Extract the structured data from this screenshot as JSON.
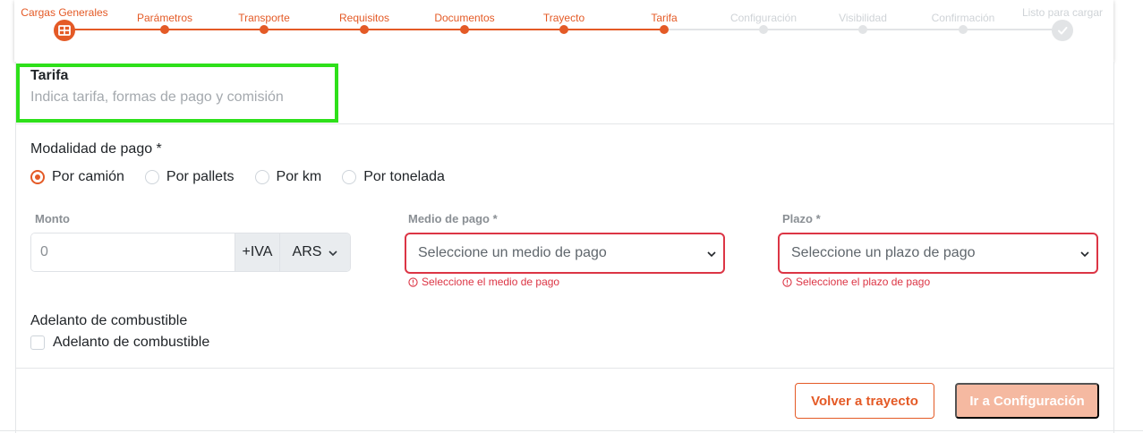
{
  "stepper": {
    "steps": [
      {
        "label": "Cargas Generales"
      },
      {
        "label": "Parámetros"
      },
      {
        "label": "Transporte"
      },
      {
        "label": "Requisitos"
      },
      {
        "label": "Documentos"
      },
      {
        "label": "Trayecto"
      },
      {
        "label": "Tarifa"
      },
      {
        "label": "Configuración"
      },
      {
        "label": "Visibilidad"
      },
      {
        "label": "Confirmación"
      },
      {
        "label": "Listo para cargar"
      }
    ],
    "active_color": "#e45a26",
    "pending_color": "#e2e4e6"
  },
  "section": {
    "title": "Tarifa",
    "subtitle": "Indica tarifa, formas de pago y comisión"
  },
  "payment_mode": {
    "label": "Modalidad de pago *",
    "options": [
      {
        "label": "Por camión",
        "checked": true
      },
      {
        "label": "Por pallets",
        "checked": false
      },
      {
        "label": "Por km",
        "checked": false
      },
      {
        "label": "Por tonelada",
        "checked": false
      }
    ]
  },
  "amount": {
    "label": "Monto",
    "placeholder": "0",
    "iva": "+IVA",
    "currency": "ARS"
  },
  "payment_method": {
    "label": "Medio de pago *",
    "placeholder": "Seleccione un medio de pago",
    "error": "Seleccione el medio de pago"
  },
  "term": {
    "label": "Plazo *",
    "placeholder": "Seleccione un plazo de pago",
    "error": "Seleccione el plazo de pago"
  },
  "fuel_advance": {
    "label": "Adelanto de combustible",
    "checkbox_label": "Adelanto de combustible"
  },
  "actions": {
    "back": "Volver a trayecto",
    "next": "Ir a Configuración"
  }
}
